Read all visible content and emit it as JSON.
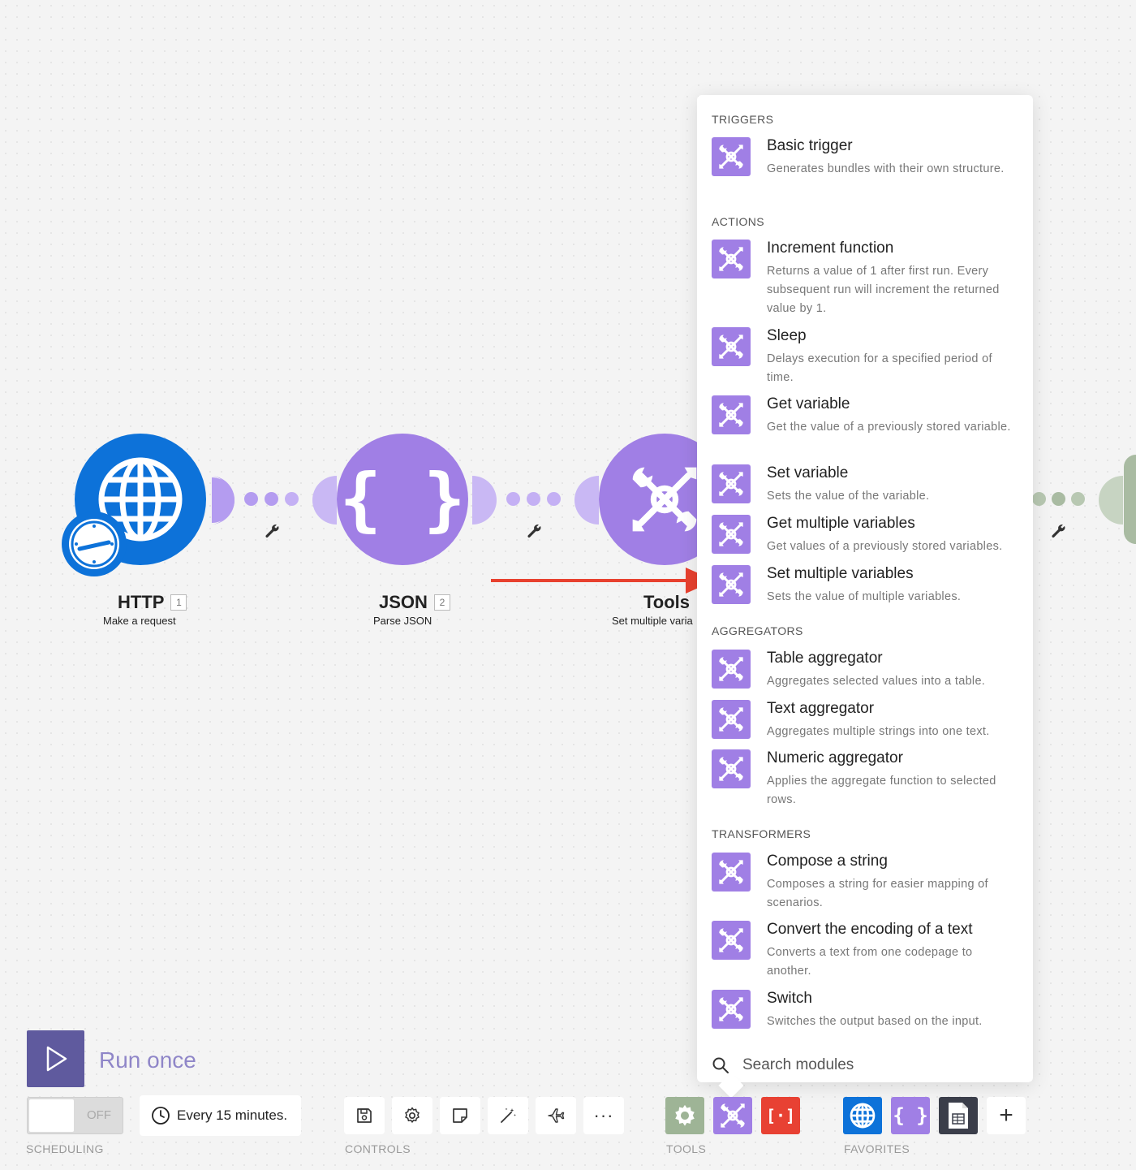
{
  "colors": {
    "purple": "#a07fe5",
    "blue": "#0d72d9",
    "red": "#e84133",
    "green": "#9eb496",
    "run": "#5f5a9e"
  },
  "modules": [
    {
      "name": "HTTP",
      "number": "1",
      "subtitle": "Make a request",
      "icon": "globe-icon"
    },
    {
      "name": "JSON",
      "number": "2",
      "subtitle": "Parse JSON",
      "icon": "braces-icon"
    },
    {
      "name": "Tools",
      "subtitle": "Set multiple varia",
      "icon": "tools-icon"
    }
  ],
  "panel": {
    "sections": {
      "triggers": "TRIGGERS",
      "actions": "ACTIONS",
      "aggregators": "AGGREGATORS",
      "transformers": "TRANSFORMERS"
    },
    "items": [
      {
        "title": "Basic trigger",
        "desc": "Generates bundles with their own structure."
      },
      {
        "title": "Increment function",
        "desc": "Returns a value of 1 after first run. Every subsequent run will increment the returned value by 1."
      },
      {
        "title": "Sleep",
        "desc": "Delays execution for a specified period of time."
      },
      {
        "title": "Get variable",
        "desc": "Get the value of a previously stored variable."
      },
      {
        "title": "Set variable",
        "desc": "Sets the value of the variable."
      },
      {
        "title": "Get multiple variables",
        "desc": "Get values of a previously stored variables."
      },
      {
        "title": "Set multiple variables",
        "desc": "Sets the value of multiple variables."
      },
      {
        "title": "Table aggregator",
        "desc": "Aggregates selected values into a table."
      },
      {
        "title": "Text aggregator",
        "desc": "Aggregates multiple strings into one text."
      },
      {
        "title": "Numeric aggregator",
        "desc": "Applies the aggregate function to selected rows."
      },
      {
        "title": "Compose a string",
        "desc": "Composes a string for easier mapping of scenarios."
      },
      {
        "title": "Convert the encoding of a text",
        "desc": "Converts a text from one codepage to another."
      },
      {
        "title": "Switch",
        "desc": "Switches the output based on the input."
      }
    ],
    "search_placeholder": "Search modules"
  },
  "bottom": {
    "run_label": "Run once",
    "toggle_text": "OFF",
    "schedule_text": "Every 15 minutes.",
    "labels": {
      "scheduling": "SCHEDULING",
      "controls": "CONTROLS",
      "tools": "TOOLS",
      "favorites": "FAVORITES"
    }
  }
}
